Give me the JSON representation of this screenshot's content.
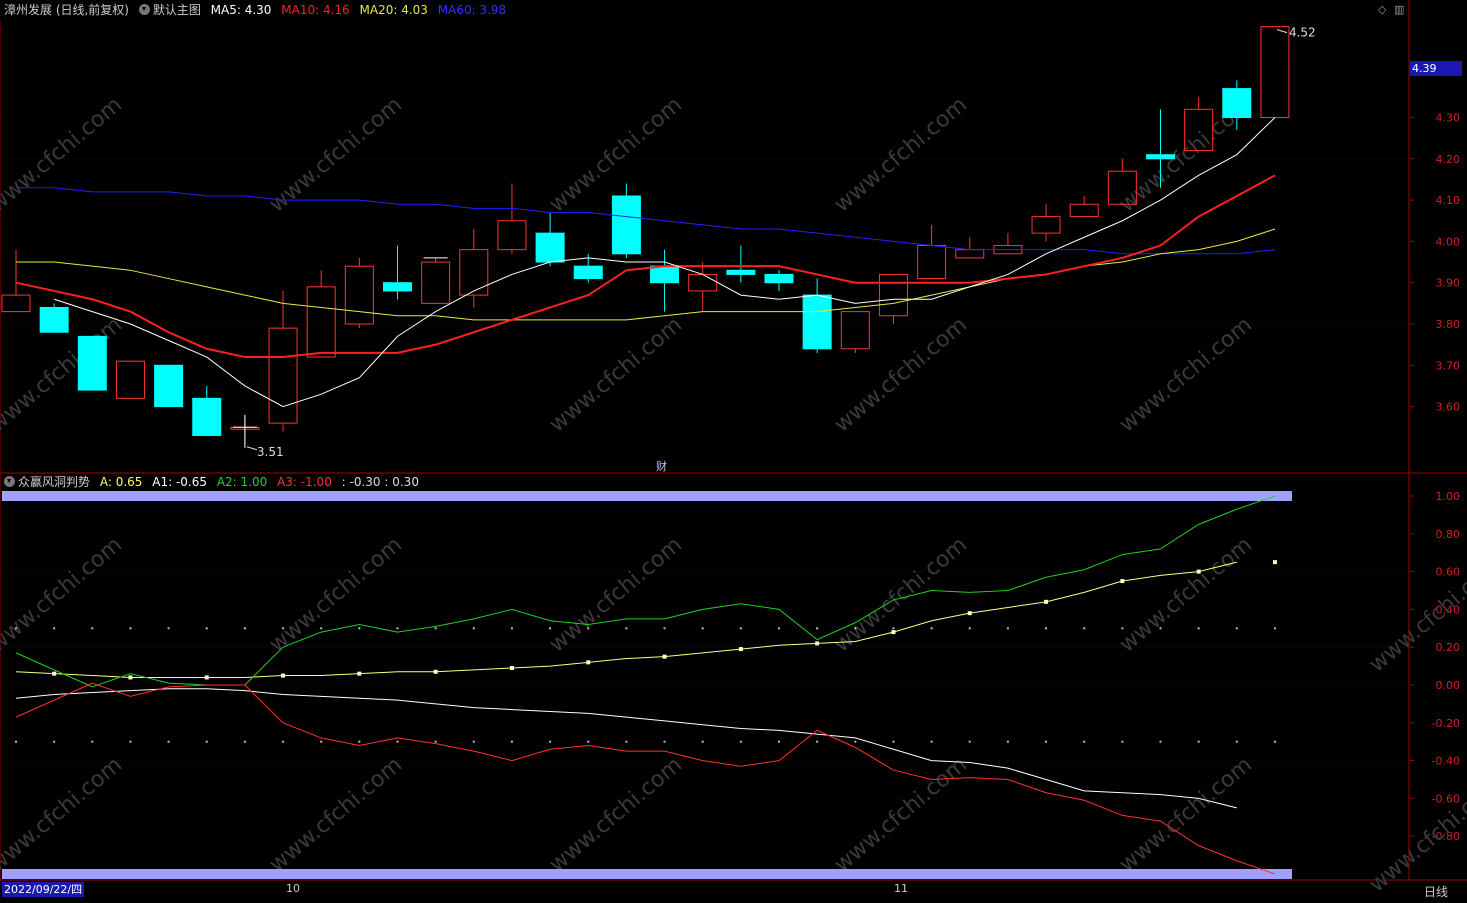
{
  "header": {
    "stock": "漳州发展 (日线,前复权)",
    "template": "默认主图",
    "ma": [
      {
        "label": "MA5: 4.30",
        "color": "#ffffff"
      },
      {
        "label": "MA10: 4.16",
        "color": "#ff2020"
      },
      {
        "label": "MA20: 4.03",
        "color": "#e8e840"
      },
      {
        "label": "MA60: 3.98",
        "color": "#2020ff"
      }
    ]
  },
  "indicator": {
    "name": "众赢风洞判势",
    "items": [
      {
        "label": "A: 0.65",
        "color": "#ffff66"
      },
      {
        "label": "A1: -0.65",
        "color": "#ffffff"
      },
      {
        "label": "A2: 1.00",
        "color": "#20d020"
      },
      {
        "label": "A3: -1.00",
        "color": "#ff3030"
      },
      {
        "label": ": -0.30 : 0.30",
        "color": "#dddddd"
      }
    ]
  },
  "price_tag": "4.39",
  "date_tag": "2022/09/22/四",
  "period": "日线",
  "months": [
    "10",
    "11"
  ],
  "fin_marker": "财",
  "max_label": "4.52",
  "min_label": "3.51",
  "watermark": "www.cfchi.com",
  "colors": {
    "up": "#ff3232",
    "down": "#00ffff",
    "ma5": "#ffffff",
    "ma10": "#ff2020",
    "ma20": "#e8e840",
    "ma60": "#2020ff",
    "axis": "#a00000",
    "band": "#a0a0ff"
  },
  "chart_data": [
    {
      "type": "candlestick",
      "ylim": [
        3.5,
        4.55
      ],
      "yticks": [
        "4.30",
        "4.20",
        "4.10",
        "4.00",
        "3.90",
        "3.80",
        "3.70",
        "3.60"
      ],
      "candles": [
        {
          "o": 3.83,
          "h": 3.98,
          "l": 3.83,
          "c": 3.87
        },
        {
          "o": 3.84,
          "h": 3.85,
          "l": 3.78,
          "c": 3.78
        },
        {
          "o": 3.77,
          "h": 3.77,
          "l": 3.64,
          "c": 3.64
        },
        {
          "o": 3.62,
          "h": 3.71,
          "l": 3.62,
          "c": 3.71
        },
        {
          "o": 3.7,
          "h": 3.7,
          "l": 3.6,
          "c": 3.6
        },
        {
          "o": 3.62,
          "h": 3.65,
          "l": 3.53,
          "c": 3.53
        },
        {
          "o": 3.55,
          "h": 3.58,
          "l": 3.51,
          "c": 3.55
        },
        {
          "o": 3.56,
          "h": 3.88,
          "l": 3.54,
          "c": 3.79
        },
        {
          "o": 3.72,
          "h": 3.93,
          "l": 3.72,
          "c": 3.89
        },
        {
          "o": 3.8,
          "h": 3.96,
          "l": 3.79,
          "c": 3.94
        },
        {
          "o": 3.9,
          "h": 3.99,
          "l": 3.86,
          "c": 3.88
        },
        {
          "o": 3.85,
          "h": 3.96,
          "l": 3.85,
          "c": 3.95
        },
        {
          "o": 3.87,
          "h": 4.03,
          "l": 3.84,
          "c": 3.98
        },
        {
          "o": 3.98,
          "h": 4.14,
          "l": 3.97,
          "c": 4.05
        },
        {
          "o": 4.02,
          "h": 4.07,
          "l": 3.94,
          "c": 3.95
        },
        {
          "o": 3.94,
          "h": 3.97,
          "l": 3.9,
          "c": 3.91
        },
        {
          "o": 4.11,
          "h": 4.14,
          "l": 3.96,
          "c": 3.97
        },
        {
          "o": 3.94,
          "h": 3.98,
          "l": 3.83,
          "c": 3.9
        },
        {
          "o": 3.88,
          "h": 3.95,
          "l": 3.83,
          "c": 3.92
        },
        {
          "o": 3.93,
          "h": 3.99,
          "l": 3.9,
          "c": 3.92
        },
        {
          "o": 3.92,
          "h": 3.93,
          "l": 3.88,
          "c": 3.9
        },
        {
          "o": 3.87,
          "h": 3.91,
          "l": 3.73,
          "c": 3.74
        },
        {
          "o": 3.74,
          "h": 3.83,
          "l": 3.73,
          "c": 3.83
        },
        {
          "o": 3.82,
          "h": 3.92,
          "l": 3.8,
          "c": 3.92
        },
        {
          "o": 3.91,
          "h": 4.04,
          "l": 3.91,
          "c": 3.99
        },
        {
          "o": 3.96,
          "h": 4.01,
          "l": 3.96,
          "c": 3.98
        },
        {
          "o": 3.97,
          "h": 4.02,
          "l": 3.97,
          "c": 3.99
        },
        {
          "o": 4.02,
          "h": 4.09,
          "l": 4.0,
          "c": 4.06
        },
        {
          "o": 4.06,
          "h": 4.11,
          "l": 4.06,
          "c": 4.09
        },
        {
          "o": 4.09,
          "h": 4.2,
          "l": 4.09,
          "c": 4.17
        },
        {
          "o": 4.21,
          "h": 4.32,
          "l": 4.13,
          "c": 4.2
        },
        {
          "o": 4.22,
          "h": 4.35,
          "l": 4.22,
          "c": 4.32
        },
        {
          "o": 4.37,
          "h": 4.39,
          "l": 4.27,
          "c": 4.3
        },
        {
          "o": 4.3,
          "h": 4.52,
          "l": 4.3,
          "c": 4.52
        }
      ],
      "ma5": [
        3.86,
        3.83,
        3.8,
        3.76,
        3.72,
        3.65,
        3.6,
        3.63,
        3.67,
        3.77,
        3.83,
        3.88,
        3.92,
        3.95,
        3.96,
        3.95,
        3.95,
        3.92,
        3.87,
        3.86,
        3.87,
        3.85,
        3.86,
        3.86,
        3.89,
        3.92,
        3.97,
        4.01,
        4.05,
        4.1,
        4.16,
        4.21,
        4.3
      ],
      "ma10": [
        3.88,
        3.86,
        3.83,
        3.78,
        3.74,
        3.72,
        3.72,
        3.73,
        3.73,
        3.73,
        3.75,
        3.78,
        3.81,
        3.84,
        3.87,
        3.93,
        3.94,
        3.94,
        3.94,
        3.94,
        3.92,
        3.9,
        3.9,
        3.9,
        3.9,
        3.91,
        3.92,
        3.94,
        3.96,
        3.99,
        4.06,
        4.11,
        4.16
      ],
      "ma20": [
        3.95,
        3.94,
        3.93,
        3.91,
        3.89,
        3.87,
        3.85,
        3.84,
        3.83,
        3.82,
        3.82,
        3.81,
        3.81,
        3.81,
        3.81,
        3.81,
        3.82,
        3.83,
        3.83,
        3.83,
        3.83,
        3.84,
        3.85,
        3.87,
        3.89,
        3.91,
        3.92,
        3.94,
        3.95,
        3.97,
        3.98,
        4.0,
        4.03
      ],
      "ma60": [
        4.13,
        4.12,
        4.12,
        4.12,
        4.11,
        4.11,
        4.1,
        4.1,
        4.1,
        4.09,
        4.09,
        4.08,
        4.08,
        4.07,
        4.07,
        4.06,
        4.05,
        4.04,
        4.03,
        4.03,
        4.02,
        4.01,
        4.0,
        3.99,
        3.98,
        3.98,
        3.98,
        3.98,
        3.97,
        3.97,
        3.97,
        3.97,
        3.98
      ]
    },
    {
      "type": "line",
      "ylim": [
        -1.1,
        1.1
      ],
      "yticks": [
        "1.00",
        "0.80",
        "0.60",
        "0.40",
        "0.20",
        "0.00",
        "-0.20",
        "-0.40",
        "-0.60",
        "-0.80"
      ],
      "series": [
        {
          "name": "A",
          "values": [
            0.07,
            0.06,
            0.05,
            0.04,
            0.04,
            0.04,
            0.04,
            0.05,
            0.05,
            0.06,
            0.07,
            0.07,
            0.08,
            0.09,
            0.1,
            0.12,
            0.14,
            0.15,
            0.17,
            0.19,
            0.21,
            0.22,
            0.23,
            0.28,
            0.34,
            0.38,
            0.41,
            0.44,
            0.49,
            0.55,
            0.58,
            0.6,
            0.65
          ]
        },
        {
          "name": "A1",
          "values": [
            -0.07,
            -0.05,
            -0.04,
            -0.03,
            -0.02,
            -0.02,
            -0.03,
            -0.05,
            -0.06,
            -0.07,
            -0.08,
            -0.1,
            -0.12,
            -0.13,
            -0.14,
            -0.15,
            -0.17,
            -0.19,
            -0.21,
            -0.23,
            -0.24,
            -0.26,
            -0.28,
            -0.34,
            -0.4,
            -0.41,
            -0.44,
            -0.5,
            -0.56,
            -0.57,
            -0.58,
            -0.6,
            -0.65
          ]
        },
        {
          "name": "A2",
          "values": [
            0.17,
            0.08,
            -0.01,
            0.06,
            0.01,
            0.0,
            0.0,
            0.2,
            0.28,
            0.32,
            0.28,
            0.31,
            0.35,
            0.4,
            0.34,
            0.32,
            0.35,
            0.35,
            0.4,
            0.43,
            0.4,
            0.24,
            0.33,
            0.45,
            0.5,
            0.49,
            0.5,
            0.57,
            0.61,
            0.69,
            0.72,
            0.85,
            0.93,
            1.0
          ]
        },
        {
          "name": "A3",
          "values": [
            -0.17,
            -0.08,
            0.01,
            -0.06,
            -0.01,
            0.0,
            0.0,
            -0.2,
            -0.28,
            -0.32,
            -0.28,
            -0.31,
            -0.35,
            -0.4,
            -0.34,
            -0.32,
            -0.35,
            -0.35,
            -0.4,
            -0.43,
            -0.4,
            -0.24,
            -0.33,
            -0.45,
            -0.5,
            -0.49,
            -0.5,
            -0.57,
            -0.61,
            -0.69,
            -0.72,
            -0.85,
            -0.93,
            -1.0
          ]
        }
      ],
      "bands": [
        1.0,
        -1.0
      ],
      "dotted_levels": [
        0.3,
        -0.3
      ]
    }
  ]
}
